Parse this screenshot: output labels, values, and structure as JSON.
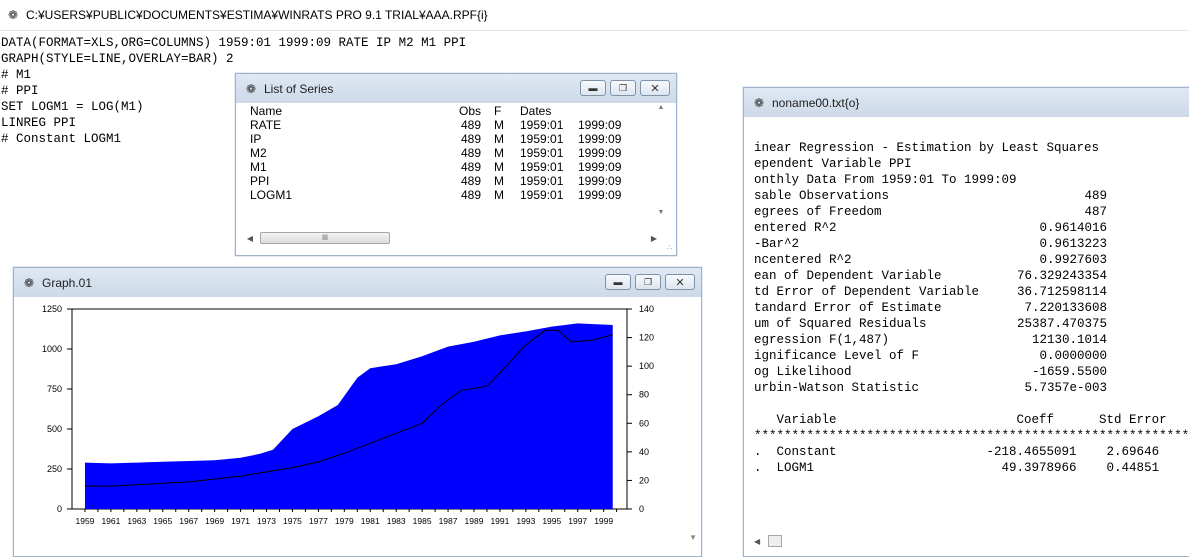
{
  "main": {
    "title": "C:¥USERS¥PUBLIC¥DOCUMENTS¥ESTIMA¥WINRATS PRO 9.1 TRIAL¥AAA.RPF{i}",
    "code_lines": [
      "DATA(FORMAT=XLS,ORG=COLUMNS) 1959:01 1999:09 RATE IP M2 M1 PPI",
      "GRAPH(STYLE=LINE,OVERLAY=BAR) 2",
      "# M1",
      "# PPI",
      "SET LOGM1 = LOG(M1)",
      "LINREG PPI",
      "# Constant LOGM1"
    ]
  },
  "list_window": {
    "title": "List of Series",
    "headers": {
      "name": "Name",
      "obs": "Obs",
      "freq": "F",
      "dates": "Dates"
    },
    "rows": [
      {
        "name": "RATE",
        "obs": "489",
        "freq": "M",
        "start": "1959:01",
        "end": "1999:09"
      },
      {
        "name": "IP",
        "obs": "489",
        "freq": "M",
        "start": "1959:01",
        "end": "1999:09"
      },
      {
        "name": "M2",
        "obs": "489",
        "freq": "M",
        "start": "1959:01",
        "end": "1999:09"
      },
      {
        "name": "M1",
        "obs": "489",
        "freq": "M",
        "start": "1959:01",
        "end": "1999:09"
      },
      {
        "name": "PPI",
        "obs": "489",
        "freq": "M",
        "start": "1959:01",
        "end": "1999:09"
      },
      {
        "name": "LOGM1",
        "obs": "489",
        "freq": "M",
        "start": "1959:01",
        "end": "1999:09"
      }
    ]
  },
  "graph_window": {
    "title": "Graph.01",
    "chart_data": {
      "type": "area",
      "x_tick_labels": [
        "1959",
        "1961",
        "1963",
        "1965",
        "1967",
        "1969",
        "1971",
        "1973",
        "1975",
        "1977",
        "1979",
        "1981",
        "1983",
        "1985",
        "1987",
        "1989",
        "1991",
        "1993",
        "1995",
        "1997",
        "1999"
      ],
      "left_axis": {
        "ticks": [
          "0",
          "250",
          "500",
          "750",
          "1000",
          "1250"
        ],
        "range": [
          0,
          1250
        ]
      },
      "right_axis": {
        "ticks": [
          "0",
          "20",
          "40",
          "60",
          "80",
          "100",
          "120",
          "140"
        ],
        "range": [
          0,
          140
        ]
      },
      "series": [
        {
          "style": "bar",
          "axis": "left",
          "color": "#0000ff",
          "x": [
            1959,
            1961,
            1963,
            1965,
            1967,
            1969,
            1971,
            1972.5,
            1973.5,
            1975,
            1977,
            1978.5,
            1980,
            1981,
            1983,
            1985,
            1987,
            1989,
            1991,
            1993,
            1995,
            1997,
            1999.7
          ],
          "values": [
            290,
            285,
            290,
            295,
            300,
            305,
            320,
            345,
            370,
            500,
            580,
            650,
            820,
            880,
            905,
            955,
            1015,
            1045,
            1085,
            1110,
            1140,
            1160,
            1150
          ]
        },
        {
          "style": "line",
          "axis": "right",
          "color": "#000000",
          "x": [
            1959,
            1961,
            1963,
            1965,
            1967,
            1969,
            1971,
            1973,
            1975,
            1977,
            1979,
            1981,
            1983,
            1985,
            1986.5,
            1988,
            1990,
            1991.5,
            1993,
            1994.5,
            1995.5,
            1996.5,
            1998,
            1999.7
          ],
          "values": [
            16,
            16,
            17,
            18,
            19,
            21,
            23,
            26,
            29,
            33,
            39,
            46,
            53,
            60,
            73,
            83,
            86,
            100,
            115,
            125,
            125,
            117,
            118,
            122
          ]
        }
      ]
    }
  },
  "output_window": {
    "title": "noname00.txt{o}",
    "header_lines": [
      "inear Regression - Estimation by Least Squares",
      "ependent Variable PPI",
      "onthly Data From 1959:01 To 1999:09"
    ],
    "stats": [
      {
        "label": "sable Observations",
        "value": "489"
      },
      {
        "label": "egrees of Freedom",
        "value": "487"
      },
      {
        "label": "entered R^2",
        "value": "0.9614016"
      },
      {
        "label": "-Bar^2",
        "value": "0.9613223"
      },
      {
        "label": "ncentered R^2",
        "value": "0.9927603"
      },
      {
        "label": "ean of Dependent Variable",
        "value": "76.329243354"
      },
      {
        "label": "td Error of Dependent Variable",
        "value": "36.712598114"
      },
      {
        "label": "tandard Error of Estimate",
        "value": "7.220133608"
      },
      {
        "label": "um of Squared Residuals",
        "value": "25387.470375"
      },
      {
        "label": "egression F(1,487)",
        "value": "12130.1014"
      },
      {
        "label": "ignificance Level of F",
        "value": "0.0000000"
      },
      {
        "label": "og Likelihood",
        "value": "-1659.5500"
      },
      {
        "label": "urbin-Watson Statistic",
        "value": "5.7357e-003"
      }
    ],
    "coef_header": "   Variable                        Coeff      Std Error",
    "separator": "**************************************************************",
    "coef_rows": [
      ".  Constant                    -218.4655091    2.69646",
      ".  LOGM1                         49.3978966    0.44851"
    ]
  }
}
